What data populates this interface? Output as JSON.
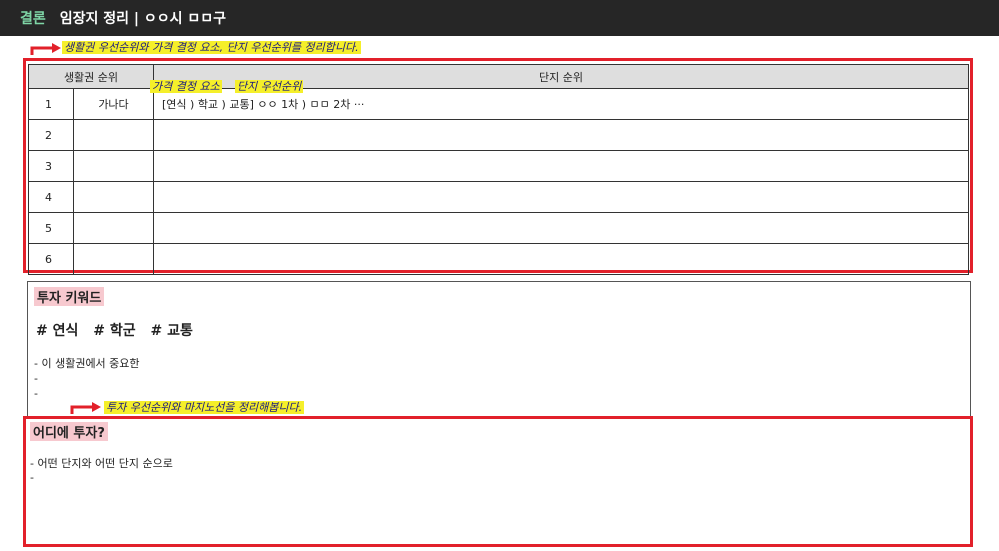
{
  "header": {
    "tag": "결론",
    "title": "임장지 정리 | ㅇㅇ시 ㅁㅁ구"
  },
  "notes": {
    "top": "생활권 우선순위와 가격 결정 요소, 단지 우선순위를 정리합니다.",
    "price_factor": "가격 결정 요소",
    "complex_priority": "단지 우선순위",
    "invest": "투자 우선순위와 마지노선을 정리해봅니다."
  },
  "table": {
    "col_area": "생활권 순위",
    "col_complex": "단지 순위",
    "rows": [
      {
        "rank": "1",
        "area": "가나다",
        "complex": "[연식 ) 학교 ) 교통] ㅇㅇ 1차 ) ㅁㅁ 2차 ···"
      },
      {
        "rank": "2",
        "area": "",
        "complex": ""
      },
      {
        "rank": "3",
        "area": "",
        "complex": ""
      },
      {
        "rank": "4",
        "area": "",
        "complex": ""
      },
      {
        "rank": "5",
        "area": "",
        "complex": ""
      },
      {
        "rank": "6",
        "area": "",
        "complex": ""
      }
    ]
  },
  "keywords": {
    "heading": "투자 키워드",
    "tags": [
      "# 연식",
      "# 학군",
      "# 교통"
    ],
    "lines": [
      "- 이 생활권에서 중요한",
      "-",
      "-"
    ]
  },
  "invest": {
    "heading": "어디에 투자?",
    "lines": [
      "- 어떤 단지와 어떤 단지 순으로",
      "-"
    ]
  },
  "colors": {
    "annotation_red": "#e2202a",
    "note_yellow": "#f5ef2a",
    "heading_pink": "#f7c9cf",
    "tag_green": "#7fd6a7"
  }
}
